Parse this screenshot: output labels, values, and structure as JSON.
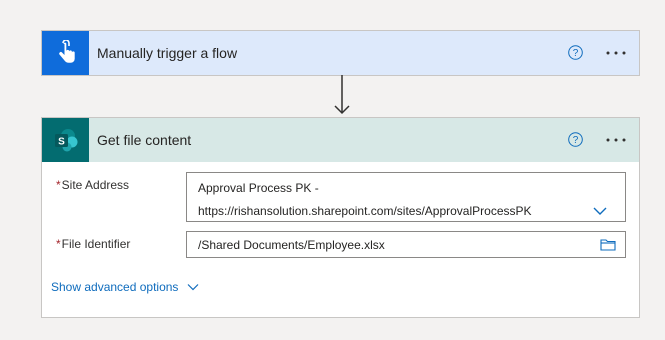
{
  "trigger": {
    "title": "Manually trigger a flow",
    "icon": "touch-hand-icon",
    "color": "#0f6cdb"
  },
  "action": {
    "title": "Get file content",
    "icon": "sharepoint-icon",
    "color": "#036c70",
    "fields": {
      "site_address": {
        "label": "Site Address",
        "required_mark": "*",
        "value_line1": "Approval Process PK -",
        "value_line2": "https://rishansolution.sharepoint.com/sites/ApprovalProcessPK"
      },
      "file_identifier": {
        "label": "File Identifier",
        "required_mark": "*",
        "value": "/Shared Documents/Employee.xlsx"
      }
    },
    "advanced_label": "Show advanced options"
  }
}
